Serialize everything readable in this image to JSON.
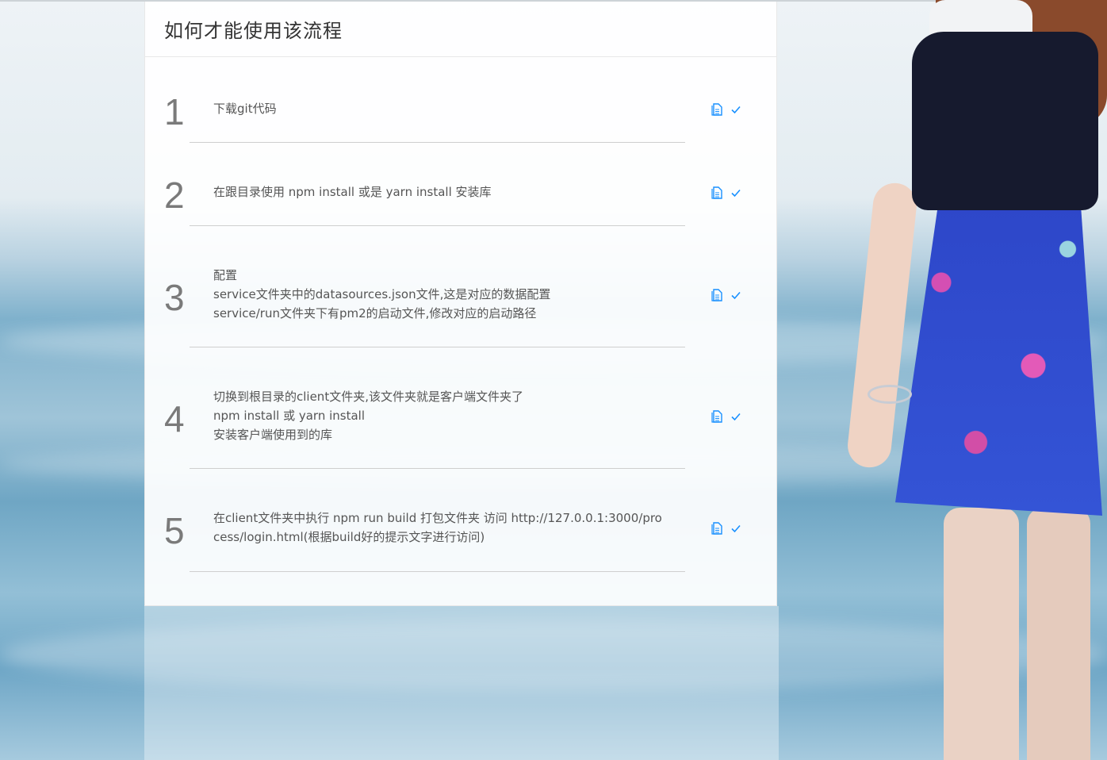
{
  "card": {
    "title": "如何才能使用该流程"
  },
  "steps": [
    {
      "number": "1",
      "lines": [
        "下载git代码"
      ]
    },
    {
      "number": "2",
      "lines": [
        "在跟目录使用 npm install 或是 yarn install 安装库"
      ]
    },
    {
      "number": "3",
      "lines": [
        "配置",
        "service文件夹中的datasources.json文件,这是对应的数据配置",
        "service/run文件夹下有pm2的启动文件,修改对应的启动路径"
      ]
    },
    {
      "number": "4",
      "lines": [
        "切换到根目录的client文件夹,该文件夹就是客户端文件夹了",
        "npm install 或 yarn install",
        "安装客户端使用到的库"
      ]
    },
    {
      "number": "5",
      "lines": [
        "在client文件夹中执行 npm run build 打包文件夹 访问 http://127.0.0.1:3000/process/login.html(根据build好的提示文字进行访问)"
      ]
    }
  ],
  "icons": {
    "copy": "file-copy-icon",
    "check": "check-icon"
  },
  "colors": {
    "accent": "#1890ff",
    "number": "#7a7a7a",
    "text": "#555555"
  }
}
